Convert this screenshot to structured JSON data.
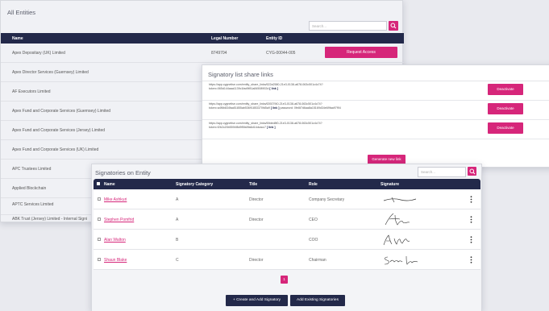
{
  "entities": {
    "title": "All Entities",
    "search_placeholder": "Search...",
    "columns": [
      "Name",
      "Legal Number",
      "Entity ID"
    ],
    "rows": [
      {
        "name": "Apex Depositary (UK) Limited",
        "legal": "8749704",
        "id": "CYG-00044-005",
        "action": "Request Access"
      },
      {
        "name": "Apex Director Services (Guernsey) Limited",
        "legal": "",
        "id": "",
        "action": ""
      },
      {
        "name": "AF Executors Limited",
        "legal": "",
        "id": "",
        "action": ""
      },
      {
        "name": "Apex Fund and Corporate Services (Guernsey) Limited",
        "legal": "",
        "id": "",
        "action": ""
      },
      {
        "name": "Apex Fund and Corporate Services (Jersey) Limited",
        "legal": "",
        "id": "",
        "action": ""
      },
      {
        "name": "Apex Fund and Corporate Services (UK) Limited",
        "legal": "",
        "id": "",
        "action": ""
      },
      {
        "name": "APC Trustees Limited",
        "legal": "",
        "id": "",
        "action": ""
      },
      {
        "name": "Applied Blockchain",
        "legal": "",
        "id": "",
        "action": ""
      },
      {
        "name": "APTC Services Limited",
        "legal": "",
        "id": "",
        "action": ""
      },
      {
        "name": "ABK Trust (Jersey) Limited - Internal Signi",
        "legal": "",
        "id": "",
        "action": ""
      }
    ]
  },
  "share_links": {
    "title": "Signatory list share links",
    "links": [
      {
        "line1": "https://app.cygnetise.com/entity_share_links/622a2580-21e3-0138-a678-063c501c4c74?",
        "line2": "token=065d144aaa1139c1fad9f81a84508902d",
        "link_label": "[ link ]",
        "extra": "",
        "button": "Deactivate"
      },
      {
        "line1": "https://app.cygnetise.com/entity_share_links/63927f40-21e3-0138-a678-063c501c4c74?",
        "line2": "token=a4f6b834faa51855ab53691853370fd5a9",
        "link_label": "[ link ]",
        "extra": "password: 0fe8t7d6aa8a15169d34e69faa97f94",
        "button": "Deactivate"
      },
      {
        "line1": "https://app.cygnetise.com/entity_share_links/69ded8f0-21e3-0138-a678-063c501c4c74?",
        "line2": "token=f2b2c20b5594f8d9f5fa9fa6d14dcacc7",
        "link_label": "[ link ]",
        "extra": "",
        "button": "Deactivate"
      }
    ],
    "generate_label": "Generate new link"
  },
  "signatories": {
    "title": "Signatories on Entity",
    "search_placeholder": "Search...",
    "columns": [
      "Name",
      "Signatory Category",
      "Title",
      "Role",
      "Signature"
    ],
    "rows": [
      {
        "name": "Mike Ashkuri",
        "category": "A",
        "title": "Director",
        "role": "Company Secretary"
      },
      {
        "name": "Stephen Pomfrid",
        "category": "A",
        "title": "Director",
        "role": "CEO"
      },
      {
        "name": "Alan Walton",
        "category": "B",
        "title": "",
        "role": "COO"
      },
      {
        "name": "Shaun Blake",
        "category": "C",
        "title": "Director",
        "role": "Chairman"
      }
    ],
    "page": "1",
    "create_label": "+ Create and Add Signatory",
    "add_existing_label": "Add Existing Signatories"
  },
  "colors": {
    "accent": "#d6267a",
    "navy": "#23294a"
  }
}
